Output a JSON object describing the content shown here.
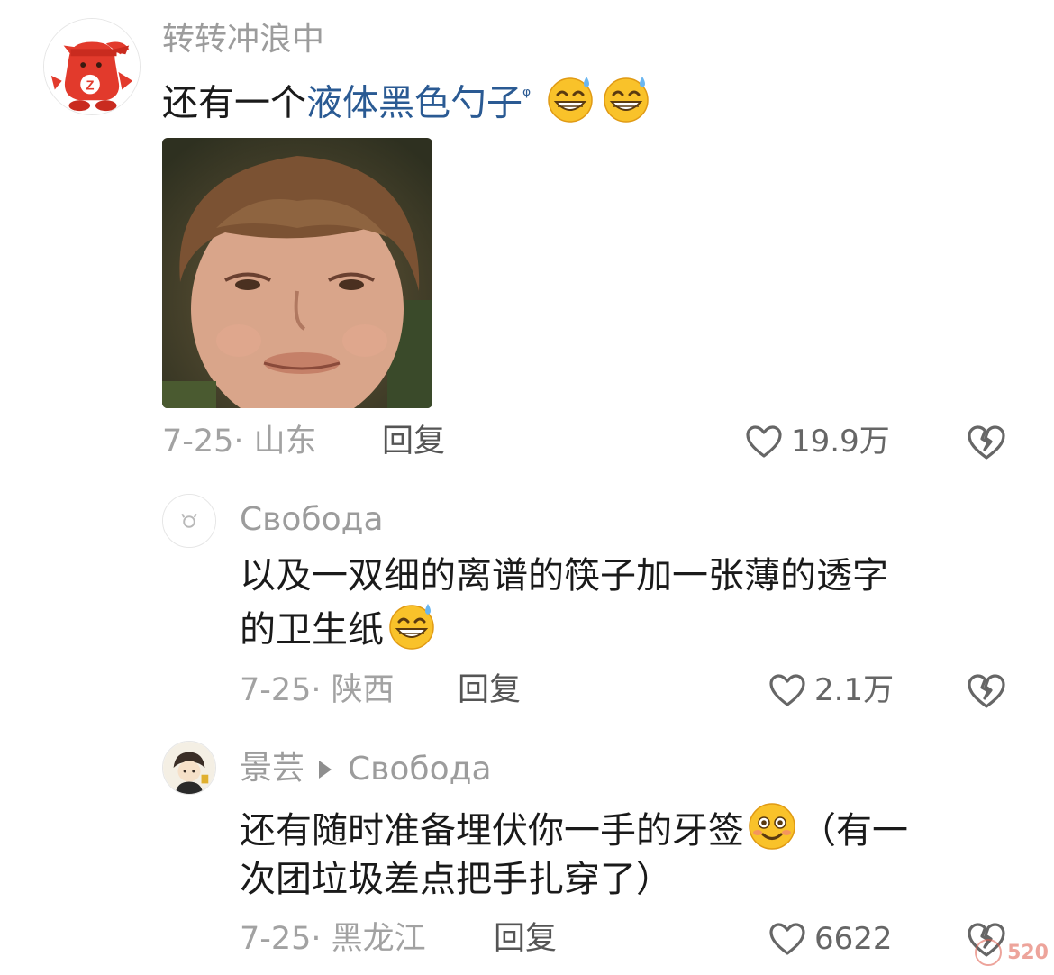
{
  "comments": [
    {
      "username": "转转冲浪中",
      "text_prefix": "还有一个",
      "text_link": "液体黑色勺子",
      "search_mark": "ᵠ",
      "date": "7-25· 山东",
      "reply_label": "回复",
      "likes": "19.9万",
      "emoji": "grinning-sweat"
    },
    {
      "username": "Свобода",
      "text_line1": "以及一双细的离谱的筷子加一张薄的透字",
      "text_line2": "的卫生纸",
      "date": "7-25· 陕西",
      "reply_label": "回复",
      "likes": "2.1万",
      "emoji": "grinning-sweat"
    },
    {
      "username": "景芸",
      "reply_to": "Свобода",
      "text_line1_a": "还有随时准备埋伏你一手的牙签",
      "text_line1_b": "（有一",
      "text_line2": "次团垃圾差点把手扎穿了）",
      "date": "7-25· 黑龙江",
      "reply_label": "回复",
      "likes": "6622",
      "emoji": "smiling-blush"
    }
  ],
  "watermark": "520",
  "colors": {
    "link": "#2a5a93",
    "username": "#9c9c9c",
    "meta": "#a2a2a2",
    "text": "#1a1a1a"
  }
}
